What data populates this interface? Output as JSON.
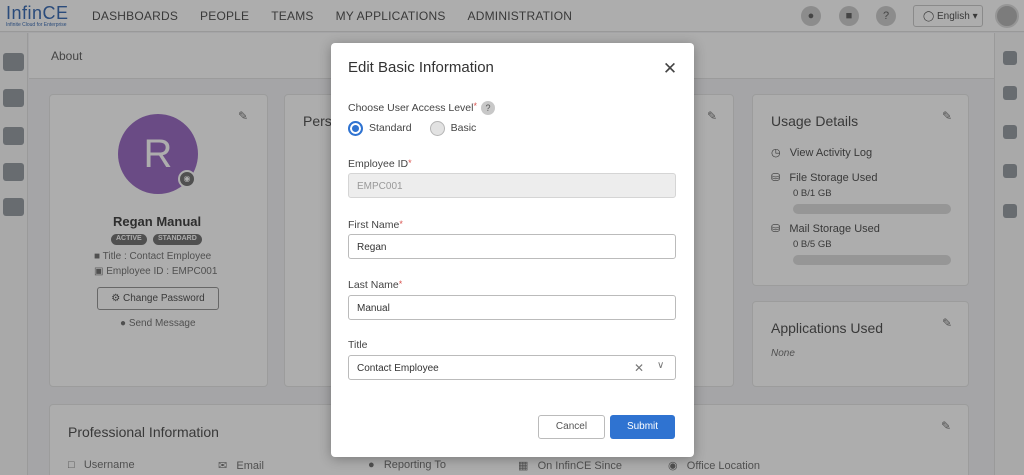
{
  "logo": {
    "name": "InfinCE",
    "tagline": "Infinite Cloud for Enterprise"
  },
  "nav": [
    "DASHBOARDS",
    "PEOPLE",
    "TEAMS",
    "MY APPLICATIONS",
    "ADMINISTRATION"
  ],
  "header": {
    "language": "English",
    "help": "?",
    "icons": [
      "bell-icon",
      "notes-icon",
      "help-icon"
    ]
  },
  "breadcrumb": "About",
  "profile": {
    "initial": "R",
    "name": "Regan Manual",
    "status_badge": "ACTIVE",
    "access_badge": "STANDARD",
    "title_line": "Title : Contact Employee",
    "employee_id_line": "Employee ID : EMPC001",
    "change_password": "Change Password",
    "send_message": "Send Message"
  },
  "personal_card": {
    "title": "Pers"
  },
  "usage": {
    "title": "Usage Details",
    "activity_log": "View Activity Log",
    "file_storage_label": "File Storage Used",
    "file_storage_value": "0 B/1 GB",
    "file_storage_fraction": 0,
    "mail_storage_label": "Mail Storage Used",
    "mail_storage_value": "0 B/5 GB",
    "mail_storage_fraction": 0
  },
  "applications": {
    "title": "Applications Used",
    "value": "None"
  },
  "professional": {
    "title": "Professional Information",
    "columns": [
      "Username",
      "Email",
      "Reporting To",
      "On InfinCE Since",
      "Office Location"
    ]
  },
  "modal": {
    "title": "Edit Basic Information",
    "access_label": "Choose User Access Level",
    "access_options": [
      "Standard",
      "Basic"
    ],
    "access_selected": "Standard",
    "employee_id_label": "Employee ID",
    "employee_id_value": "EMPC001",
    "first_name_label": "First Name",
    "first_name_value": "Regan",
    "last_name_label": "Last Name",
    "last_name_value": "Manual",
    "title_label": "Title",
    "title_value": "Contact Employee",
    "cancel": "Cancel",
    "submit": "Submit"
  },
  "colors": {
    "accent": "#2f73d1",
    "avatar": "#9c6fc4",
    "required": "#d9534f"
  }
}
